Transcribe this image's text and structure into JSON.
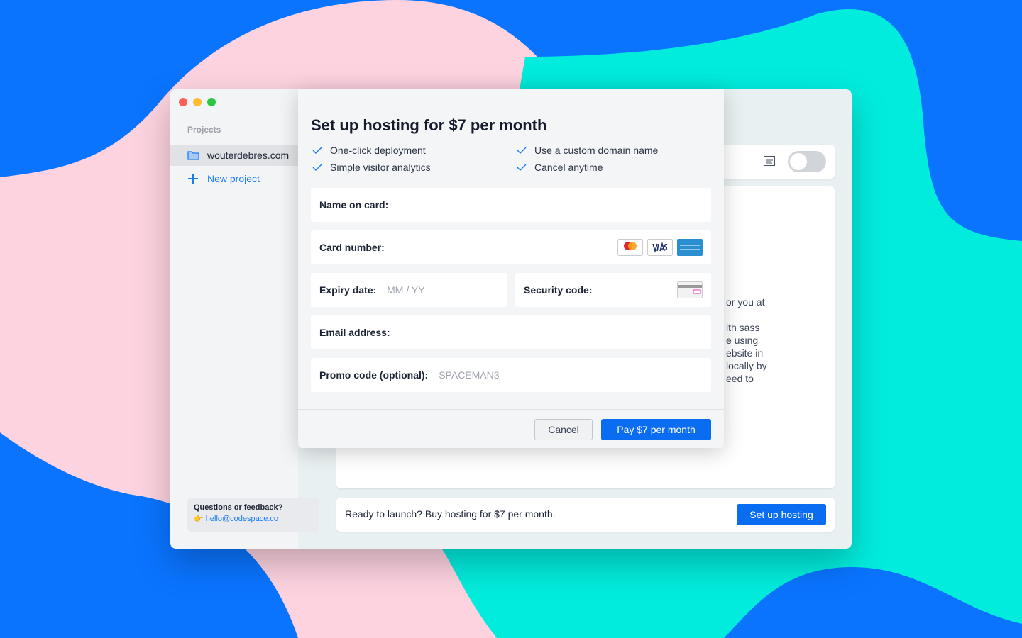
{
  "colors": {
    "background_blue": "#0a74ff",
    "blob_pink": "#fdd3e0",
    "blob_cyan": "#02ecdd",
    "accent": "#0a6cf0"
  },
  "sidebar": {
    "section_label": "Projects",
    "items": [
      {
        "label": "wouterdebres.com",
        "icon": "folder-icon"
      }
    ],
    "new_project_label": "New project",
    "feedback": {
      "question": "Questions or feedback?",
      "email": "hello@codespace.co",
      "icon": "pointing-hand-emoji"
    }
  },
  "main": {
    "content_fragments": [
      "or you at",
      "ith sass",
      "e using",
      "ebsite in",
      "locally by",
      "eed to"
    ],
    "bottom_bar": {
      "text": "Ready to launch? Buy hosting for $7 per month.",
      "button": "Set up hosting"
    }
  },
  "modal": {
    "title": "Set up hosting for $7 per month",
    "features": [
      "One-click deployment",
      "Use a custom domain name",
      "Simple visitor analytics",
      "Cancel anytime"
    ],
    "fields": {
      "name": {
        "label": "Name on card:",
        "value": ""
      },
      "card": {
        "label": "Card number:",
        "value": "",
        "card_logos": [
          "mastercard",
          "visa",
          "american-express"
        ]
      },
      "expiry": {
        "label": "Expiry date:",
        "placeholder": "MM / YY"
      },
      "security": {
        "label": "Security code:",
        "value": ""
      },
      "email": {
        "label": "Email address:",
        "value": ""
      },
      "promo": {
        "label": "Promo code (optional):",
        "placeholder": "SPACEMAN3"
      }
    },
    "cancel_label": "Cancel",
    "pay_label": "Pay $7 per month"
  }
}
